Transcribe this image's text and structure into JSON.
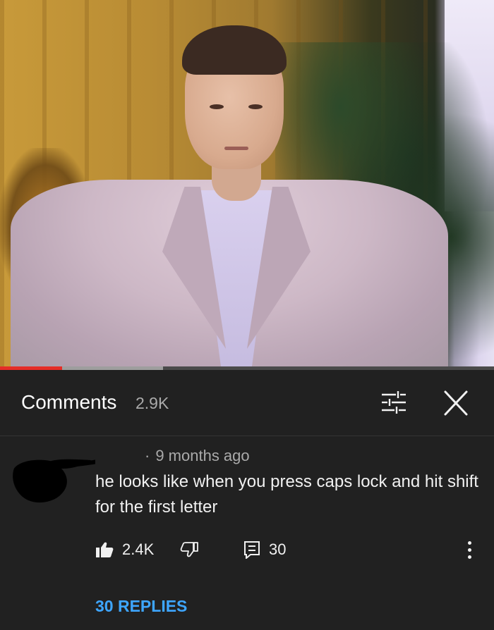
{
  "video": {
    "progress_fraction": 0.125,
    "buffered_fraction": 0.33,
    "colors": {
      "played": "#e52d27",
      "buffered": "#9e9e9e",
      "track": "#4a4a4a"
    }
  },
  "comments_header": {
    "title": "Comments",
    "count": "2.9K",
    "filter_icon": "sliders-icon",
    "close_icon": "close-icon"
  },
  "comment": {
    "time": "9 months ago",
    "text": "he looks like when you press caps lock and hit shift for the first letter",
    "likes": "2.4K",
    "reply_count": "30",
    "replies_link": "30 REPLIES",
    "icons": [
      "thumbs-up-icon",
      "thumbs-down-icon",
      "reply-icon",
      "more-vertical-icon"
    ]
  },
  "colors": {
    "background": "#212121",
    "link": "#3ea6ff",
    "secondary_text": "#aaaaaa"
  }
}
